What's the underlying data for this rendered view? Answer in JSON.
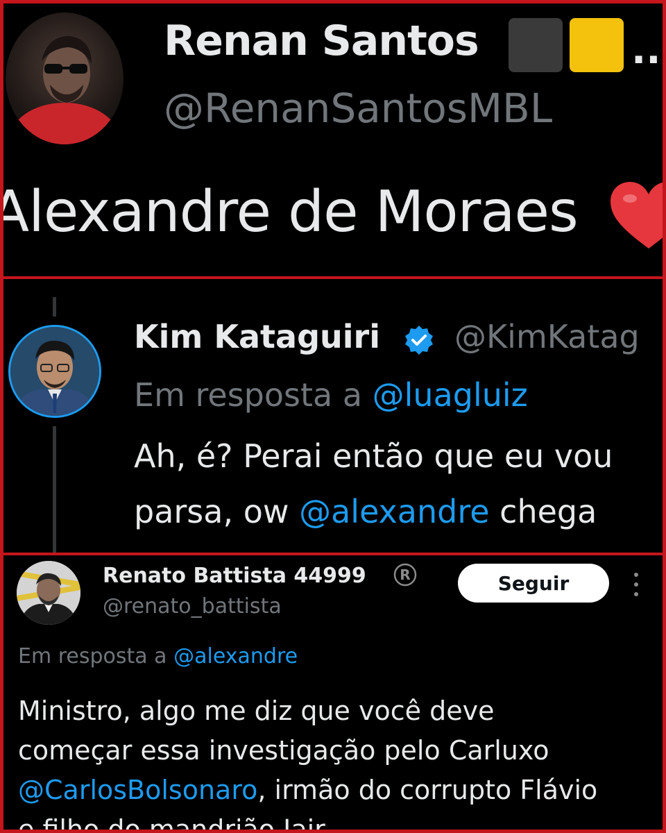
{
  "panel1": {
    "name": "Renan Santos",
    "handle": "@RenanSantosMBL",
    "tweet_text": "Alexandre de Moraes",
    "squares_colors": [
      "#3a3a3a",
      "#f4c20d"
    ],
    "ellipsis": "...",
    "icons": [
      "avatar",
      "heart-icon"
    ]
  },
  "panel2": {
    "name": "Kim Kataguiri",
    "handle": "@KimKatag",
    "reply_prefix": "Em resposta a",
    "reply_to": "@luagluiz",
    "line1": "Ah, é? Perai então que eu vou",
    "line2_before": "parsa, ow ",
    "line2_mention": "@alexandre",
    "line2_after": " chega",
    "icons": [
      "verified-badge-icon"
    ]
  },
  "panel3": {
    "name": "Renato Battista 44999",
    "handle": "@renato_battista",
    "follow_label": "Seguir",
    "reply_prefix": "Em resposta a",
    "reply_to": "@alexandre",
    "body_line1": "Ministro, algo me diz que você deve",
    "body_line2": "começar essa investigação pelo Carluxo",
    "body_line3_mention": "@CarlosBolsonaro",
    "body_line3_after": ", irmão do corrupto Flávio",
    "body_line4": "e filho do mandrião Jair",
    "icons": [
      "registered-icon",
      "more-options-icon"
    ]
  },
  "colors": {
    "border": "#c4161c",
    "link": "#1d9bf0",
    "muted": "#71767b",
    "text": "#e7e9ea"
  }
}
